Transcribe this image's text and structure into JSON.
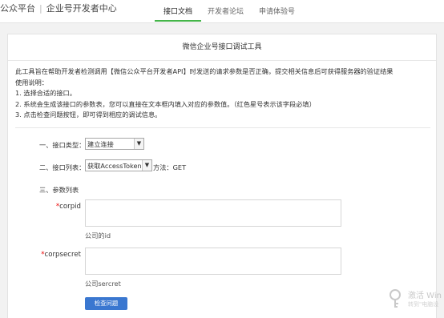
{
  "header": {
    "brand_main": "公众平台",
    "brand_sub": "企业号开发者中心",
    "nav": [
      {
        "label": "接口文档",
        "active": true
      },
      {
        "label": "开发者论坛",
        "active": false
      },
      {
        "label": "申请体验号",
        "active": false
      }
    ]
  },
  "panel": {
    "title": "微信企业号接口调试工具",
    "intro": [
      "此工具旨在帮助开发者检测调用【微信公众平台开发者API】时发送的请求参数是否正确，提交相关信息后可获得服务器的验证结果",
      "使用说明：",
      "1. 选择合适的接口。",
      "2. 系统会生成该接口的参数表，您可以直接在文本框内填入对应的参数值。（红色星号表示该字段必填）",
      "3. 点击检查问题按钮，即可得到相应的调试信息。"
    ]
  },
  "form": {
    "interface_type_label": "一、接口类型：",
    "interface_type_value": "建立连接",
    "interface_list_label": "二、接口列表：",
    "interface_list_value": "获取AccessToken",
    "method_text": "方法：GET",
    "params_label": "三、参数列表",
    "fields": [
      {
        "name": "corpid",
        "required_mark": "*",
        "hint": "公司的id"
      },
      {
        "name": "corpsecret",
        "required_mark": "*",
        "hint": "公司sercret"
      }
    ],
    "submit_label": "检查问题"
  },
  "watermark": {
    "line1": "激活 Win",
    "line2": "转到\"电脑设"
  },
  "colors": {
    "accent_green": "#44b549",
    "button_blue": "#3a77d0",
    "required_red": "#e00000"
  }
}
